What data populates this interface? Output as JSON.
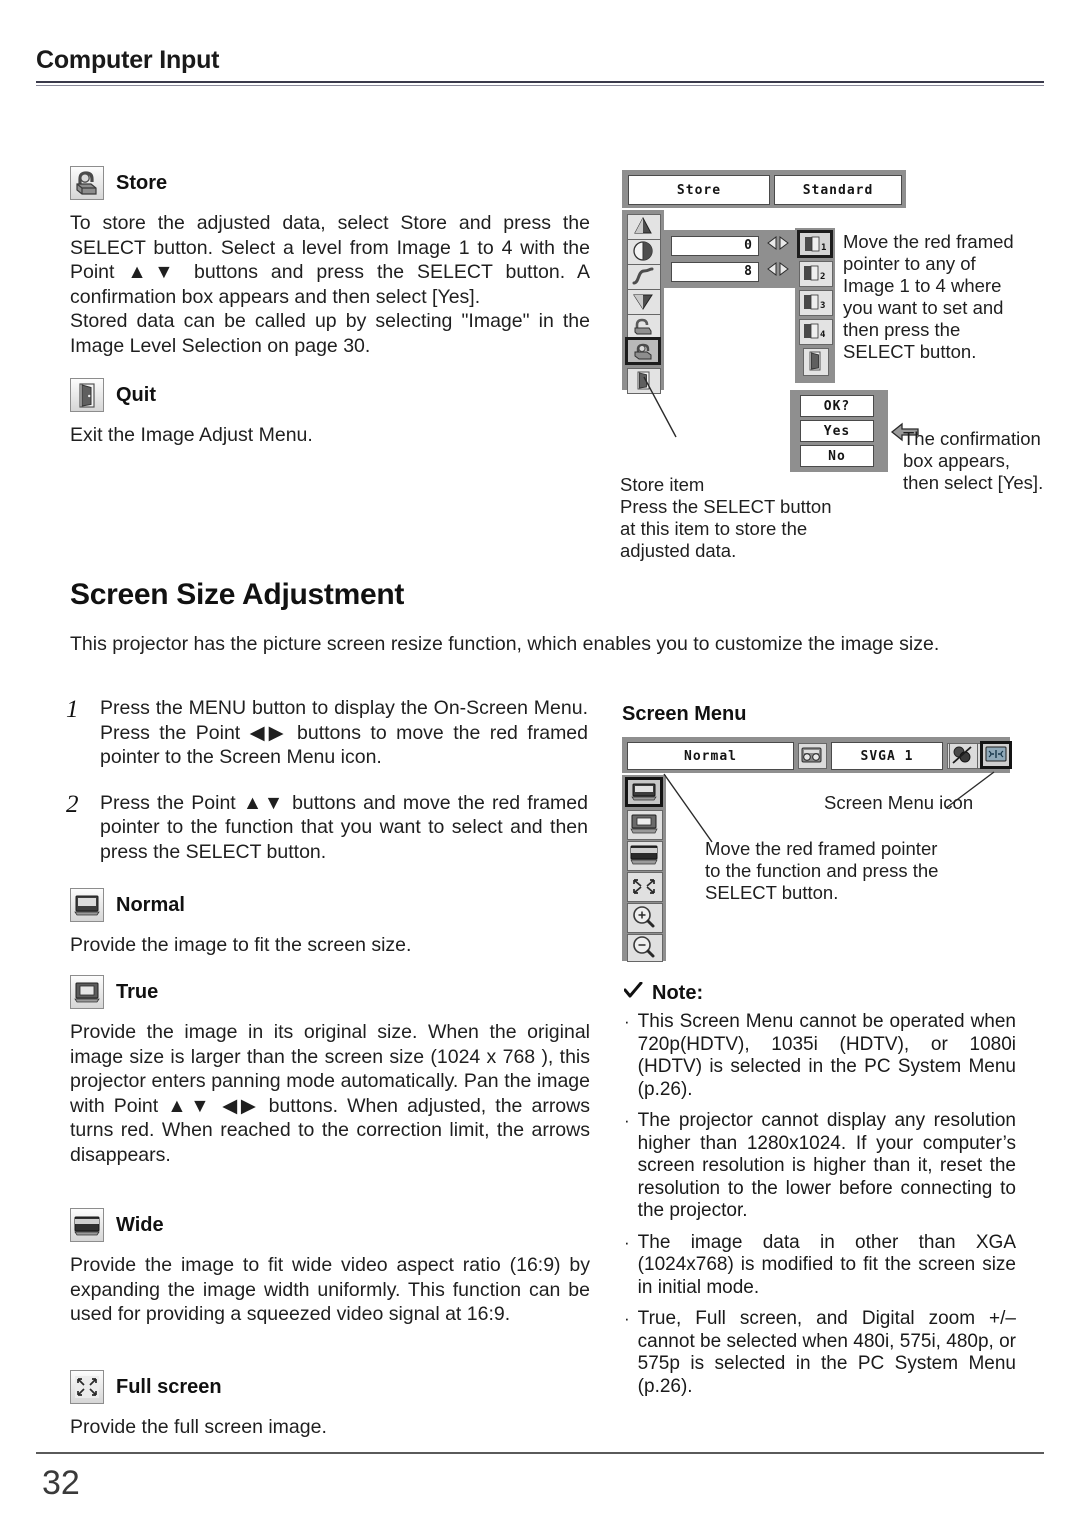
{
  "page": {
    "running_head": "Computer Input",
    "folio": "32"
  },
  "store_section": {
    "icon": "store-padlock-icon",
    "heading": "Store",
    "body": "To store the adjusted data, select Store and press the SELECT button.  Select a level from Image 1 to 4 with the Point ▲▼ buttons and press the SELECT button.  A confirmation box appears and then select [Yes].\nStored data can be called up by selecting \"Image\" in the Image Level Selection on page 30."
  },
  "quit_section": {
    "icon": "quit-door-icon",
    "heading": "Quit",
    "body": "Exit the Image Adjust Menu."
  },
  "image_adjust_osd": {
    "tab_left_label": "Store",
    "tab_right_label": "Standard",
    "value_rows": [
      {
        "value": "0",
        "arrows": "left-right-arrows-icon"
      },
      {
        "value": "8",
        "arrows": "left-right-arrows-icon"
      }
    ],
    "left_icons": [
      "contrast-triangle-icon",
      "brightness-circle-icon",
      "gamma-curve-icon",
      "color-temp-triangle-icon",
      "reset-icon",
      "store-padlock-icon",
      "quit-door-icon"
    ],
    "selected_left_icon": "store-padlock-icon",
    "image_level_icons": [
      "image-level-1-icon",
      "image-level-2-icon",
      "image-level-3-icon",
      "image-level-4-icon",
      "quit-door-icon"
    ],
    "selected_image_level": "image-level-1-icon",
    "image_level_note": "Move the red framed pointer to any of Image 1 to 4 where you want to set and then press the SELECT button.",
    "confirm_box": {
      "title": "OK?",
      "yes_label": "Yes",
      "no_label": "No",
      "pointer_icon": "left-arrow-pointer-icon"
    },
    "confirm_note": "The confirmation box appears, then select [Yes].",
    "store_callout": "Store item\nPress the SELECT button at this item to store the adjusted data."
  },
  "screen_size_section": {
    "heading": "Screen Size Adjustment",
    "intro": "This projector has the picture screen resize function, which enables you to customize the image size.",
    "steps": [
      {
        "num": "1",
        "text": "Press the MENU button to display the On-Screen Menu.  Press the Point ◀▶ buttons to move the red framed pointer to the Screen Menu icon."
      },
      {
        "num": "2",
        "text": "Press the Point ▲▼ buttons and move the red framed pointer to the function that you want to select and then press the SELECT button."
      }
    ],
    "items": [
      {
        "icon": "screen-normal-icon",
        "heading": "Normal",
        "body": "Provide the image to fit the screen size."
      },
      {
        "icon": "screen-true-icon",
        "heading": "True",
        "body": "Provide the image in its original size. When the original image size is larger than the screen size (1024 x 768 ), this projector enters panning mode automatically. Pan the image with Point ▲▼ ◀▶ buttons.  When adjusted, the arrows turns red.   When reached to the correction limit, the arrows disappears."
      },
      {
        "icon": "screen-wide-icon",
        "heading": "Wide",
        "body": "Provide the image to fit wide video aspect ratio (16:9) by expanding the image width uniformly.  This function can be used for providing a squeezed video signal at 16:9."
      },
      {
        "icon": "screen-full-icon",
        "heading": "Full screen",
        "body": "Provide the full screen image."
      }
    ]
  },
  "screen_menu_osd": {
    "caption": "Screen Menu",
    "selected_mode": "Normal",
    "system_value": "SVGA 1",
    "top_bar_icons": [
      "sound-speaker-icon",
      "computer-input-icon",
      "color-adjust-icon",
      "image-adjust-icon",
      "screen-menu-icon"
    ],
    "selected_top_icon": "screen-menu-icon",
    "side_icons": [
      "screen-normal-icon",
      "screen-true-icon",
      "screen-wide-icon",
      "screen-full-icon",
      "digital-zoom-in-icon",
      "digital-zoom-out-icon"
    ],
    "selected_side_icon": "screen-normal-icon",
    "icon_callout": "Screen Menu icon",
    "pointer_callout": "Move the red framed pointer to the function and press the SELECT button."
  },
  "note": {
    "check_icon": "check-mark-icon",
    "heading": "Note:",
    "items": [
      "This Screen Menu cannot be operated when 720p(HDTV), 1035i (HDTV), or 1080i (HDTV) is selected in the PC System Menu (p.26).",
      "The projector cannot display any resolution higher than 1280x1024. If your computer’s screen resolution is higher than it, reset the resolution to the lower before connecting to the projector.",
      "The image data in other than XGA (1024x768) is modified to fit the screen size in initial mode.",
      "True, Full screen, and Digital zoom +/– cannot be selected when 480i, 575i, 480p, or 575p is selected in the PC System Menu (p.26)."
    ]
  }
}
